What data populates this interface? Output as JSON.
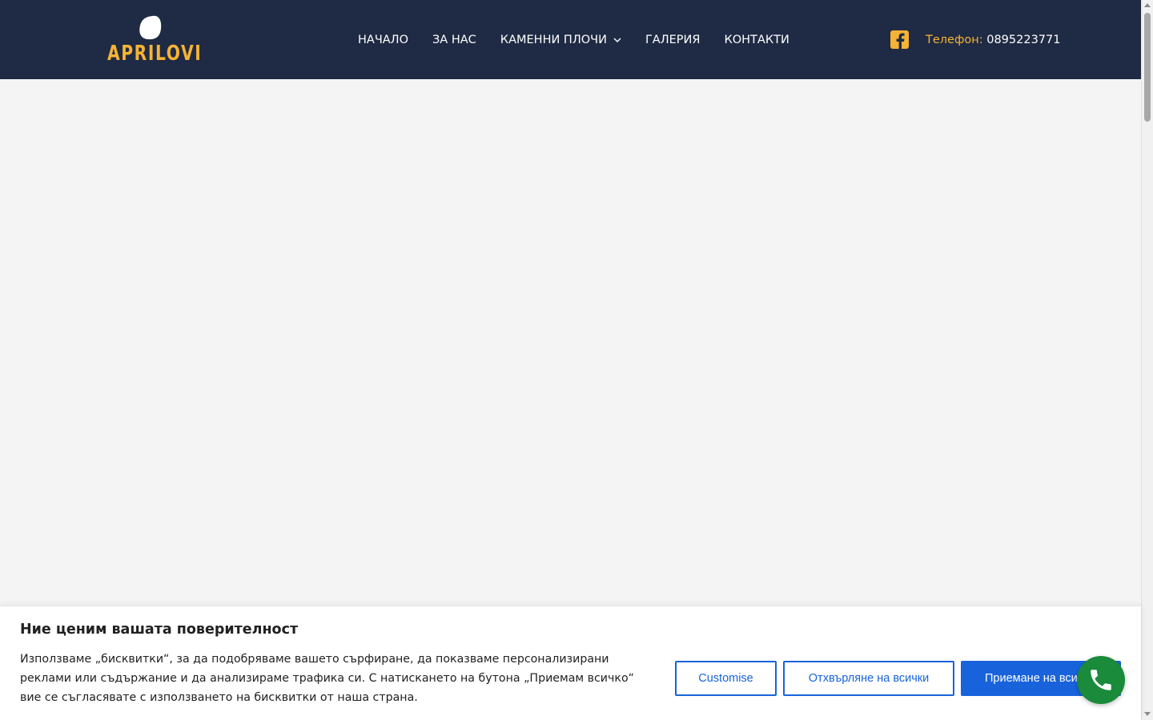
{
  "header": {
    "logo_text": "APRILOVI",
    "nav": [
      {
        "label": "НАЧАЛО"
      },
      {
        "label": "ЗА НАС"
      },
      {
        "label": "КАМЕННИ ПЛОЧИ"
      },
      {
        "label": "ГАЛЕРИЯ"
      },
      {
        "label": "КОНТАКТИ"
      }
    ],
    "social_icon": "facebook-icon",
    "phone_label": "Телефон:",
    "phone_number": "0895223771"
  },
  "cookie_banner": {
    "title": "Ние ценим вашата поверителност",
    "text": "Използваме „бисквитки“, за да подобряваме вашето сърфиране, да показваме персонализирани реклами или съдържание и да анализираме трафика си. С натискането на бутона „Приемам всичко“ вие се съгласявате с използването на бисквитки от наша страна.",
    "customise_label": "Customise",
    "reject_label": "Отхвърляне на всички",
    "accept_label": "Приемане на всички"
  },
  "floating": {
    "call_icon": "phone-icon"
  },
  "colors": {
    "header_bg": "#1f2a44",
    "accent": "#f5b335",
    "button_blue": "#1863dc",
    "call_green": "#1a8a3b"
  }
}
